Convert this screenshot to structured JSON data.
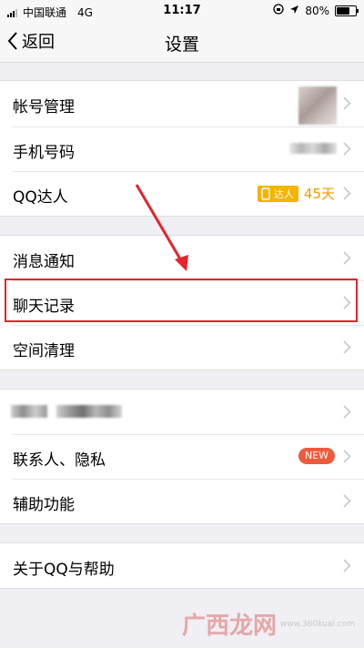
{
  "status_bar": {
    "carrier": "中国联通",
    "network": "4G",
    "time": "11:17",
    "battery": "80%",
    "battery_level": 0.8
  },
  "nav": {
    "back_label": "返回",
    "title": "设置"
  },
  "group1": {
    "account_label": "帐号管理",
    "phone_label": "手机号码",
    "qq_label": "QQ达人",
    "qq_badge_text": "达人",
    "qq_days": "45天"
  },
  "group2": {
    "notify_label": "消息通知",
    "chat_label": "聊天记录",
    "space_label": "空间清理"
  },
  "group3": {
    "contacts_label": "联系人、隐私",
    "new_badge": "NEW",
    "assist_label": "辅助功能"
  },
  "group4": {
    "about_label": "关于QQ与帮助"
  },
  "watermark": {
    "text": "广西龙网",
    "small": "www.360kuai.com"
  },
  "colors": {
    "highlight": "#e8232c",
    "accent_orange": "#f4b400",
    "new_badge": "#f05a3c",
    "background": "#efeff4"
  }
}
